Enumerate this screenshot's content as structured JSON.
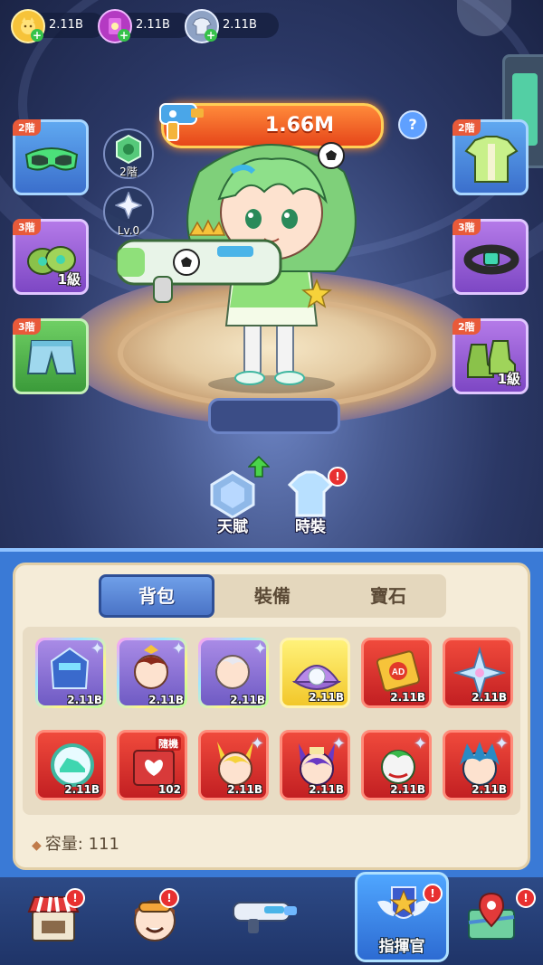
{
  "currencies": [
    {
      "icon": "cat-coin-icon",
      "value": "2.11B"
    },
    {
      "icon": "book-icon",
      "value": "2.11B"
    },
    {
      "icon": "shirt-token-icon",
      "value": "2.11B"
    }
  ],
  "power": {
    "value": "1.66M"
  },
  "help_label": "?",
  "left_slots": [
    {
      "tier": "2階",
      "item": "goggles-icon",
      "level": "",
      "rarity": "blue"
    },
    {
      "tier": "3階",
      "item": "gloves-icon",
      "level": "1級",
      "rarity": "purple"
    },
    {
      "tier": "3階",
      "item": "shorts-icon",
      "level": "",
      "rarity": "green"
    }
  ],
  "right_slots": [
    {
      "tier": "2階",
      "item": "jersey-icon",
      "level": "",
      "rarity": "blue"
    },
    {
      "tier": "3階",
      "item": "belt-icon",
      "level": "",
      "rarity": "purple"
    },
    {
      "tier": "2階",
      "item": "boots-icon",
      "level": "1級",
      "rarity": "purple"
    }
  ],
  "rank_badge": {
    "label": "2階"
  },
  "star_badge": {
    "label": "Lv.0"
  },
  "talent_button": {
    "label": "天賦"
  },
  "skin_button": {
    "label": "時裝",
    "badge": "!"
  },
  "inventory": {
    "tabs": [
      "背包",
      "裝備",
      "寶石"
    ],
    "active_tab": 0,
    "items": [
      {
        "icon": "mecha-hero-icon",
        "qty": "2.11B",
        "style": "holo"
      },
      {
        "icon": "warrior-hero-icon",
        "qty": "2.11B",
        "style": "holo"
      },
      {
        "icon": "silver-hair-hero-icon",
        "qty": "2.11B",
        "style": "holo"
      },
      {
        "icon": "pearl-shell-icon",
        "qty": "2.11B",
        "style": "gold"
      },
      {
        "icon": "ad-ticket-icon",
        "qty": "2.11B",
        "style": "red"
      },
      {
        "icon": "shuriken-icon",
        "qty": "2.11B",
        "style": "red"
      },
      {
        "icon": "sneaker-token-icon",
        "qty": "2.11B",
        "style": "red"
      },
      {
        "icon": "random-box-icon",
        "qty": "102",
        "style": "red",
        "tag": "隨機"
      },
      {
        "icon": "fox-girl-hero-icon",
        "qty": "2.11B",
        "style": "red"
      },
      {
        "icon": "cat-mage-hero-icon",
        "qty": "2.11B",
        "style": "red"
      },
      {
        "icon": "joker-hero-icon",
        "qty": "2.11B",
        "style": "red"
      },
      {
        "icon": "blue-hair-hero-icon",
        "qty": "2.11B",
        "style": "red"
      }
    ],
    "capacity_label": "容量: 111"
  },
  "bottom_nav": [
    {
      "icon": "shop-icon",
      "label": "",
      "badge": "!"
    },
    {
      "icon": "pilot-avatar-icon",
      "label": "",
      "badge": "!"
    },
    {
      "icon": "blaster-icon",
      "label": "",
      "badge": ""
    },
    {
      "icon": "commander-badge-icon",
      "label": "指揮官",
      "badge": "!",
      "active": true
    },
    {
      "icon": "map-icon",
      "label": "",
      "badge": "!"
    }
  ],
  "colors": {
    "power_banner": "#e6461a",
    "panel_blue": "#3a7ad6",
    "tier_red": "#e85a3a",
    "notify_red": "#e83030"
  }
}
